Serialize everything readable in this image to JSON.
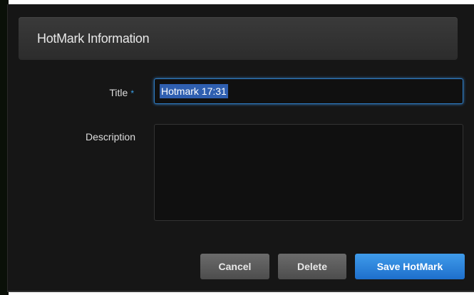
{
  "dialog": {
    "title": "HotMark Information"
  },
  "form": {
    "title_label": "Title",
    "required_marker": "*",
    "title_value": "Hotmark 17:31",
    "description_label": "Description",
    "description_value": ""
  },
  "buttons": {
    "cancel": "Cancel",
    "delete": "Delete",
    "save": "Save HotMark"
  },
  "colors": {
    "accent": "#2e7cc4",
    "save_button": "#1e6fcc",
    "dialog_bg": "#161616"
  }
}
